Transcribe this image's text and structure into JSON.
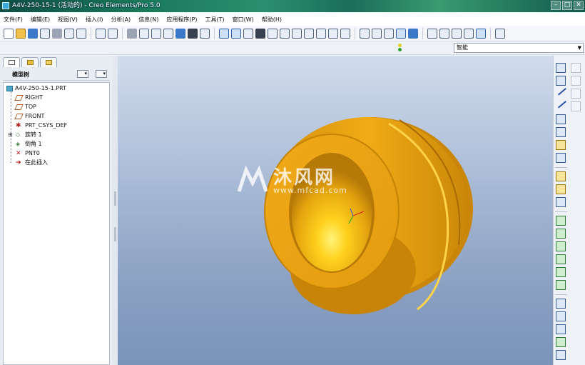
{
  "window": {
    "title": "A4V-250-15-1 (活动的) - Creo Elements/Pro 5.0",
    "controls": [
      "–",
      "□",
      "✕"
    ]
  },
  "menubar": {
    "items": [
      "文件(F)",
      "编辑(E)",
      "视图(V)",
      "插入(I)",
      "分析(A)",
      "信息(N)",
      "应用程序(P)",
      "工具(T)",
      "窗口(W)",
      "帮助(H)"
    ]
  },
  "filter": {
    "selected": "智能"
  },
  "model_tree": {
    "header": "模型树",
    "root": "A4V-250-15-1.PRT",
    "items": [
      {
        "label": "RIGHT",
        "icon": "datum-plane-icon"
      },
      {
        "label": "TOP",
        "icon": "datum-plane-icon"
      },
      {
        "label": "FRONT",
        "icon": "datum-plane-icon"
      },
      {
        "label": "PRT_CSYS_DEF",
        "icon": "csys-icon"
      },
      {
        "label": "旋转 1",
        "icon": "revolve-icon",
        "expandable": true
      },
      {
        "label": "倒角 1",
        "icon": "chamfer-icon"
      },
      {
        "label": "PNT0",
        "icon": "datum-point-icon"
      },
      {
        "label": "在此插入",
        "icon": "insert-here-icon"
      }
    ]
  },
  "watermark": {
    "main": "沐风网",
    "sub": "www.mfcad.com"
  },
  "colors": {
    "part": "#e8a112",
    "part_dark": "#b47806",
    "part_highlight": "#ffd23a",
    "viewport_top": "#d2dcec",
    "viewport_bottom": "#7a93ba"
  }
}
